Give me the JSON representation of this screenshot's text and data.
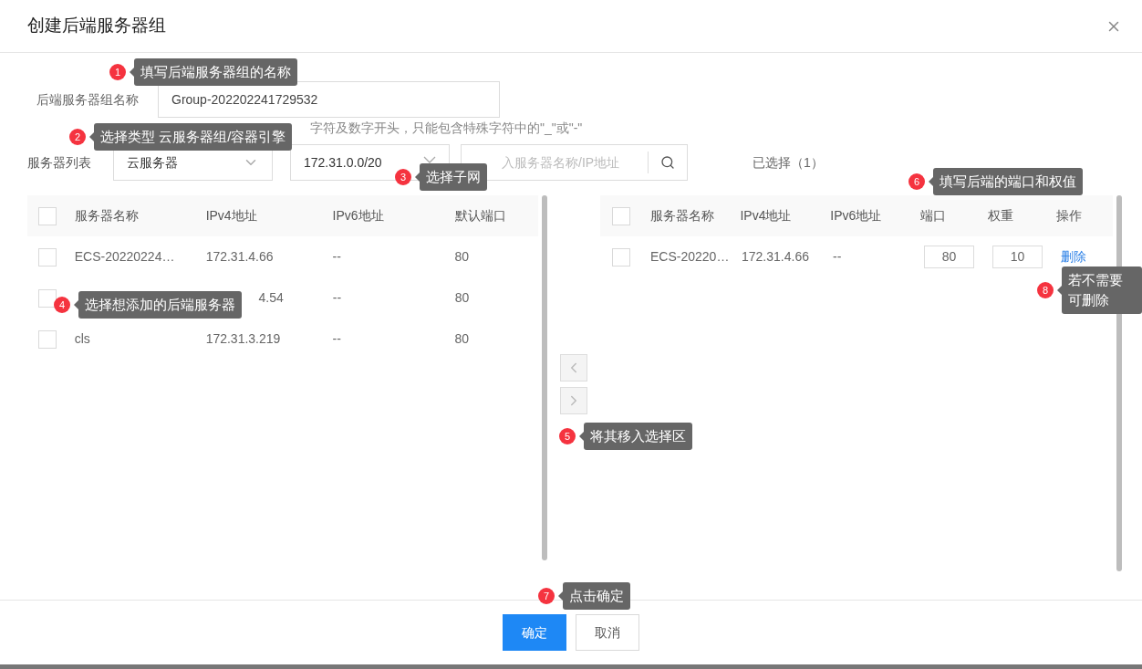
{
  "dialog": {
    "title": "创建后端服务器组"
  },
  "name_field": {
    "label": "后端服务器组名称",
    "value": "Group-202202241729532",
    "hint": "字符及数字开头，只能包含特殊字符中的\"_\"或\"-\""
  },
  "server_list": {
    "label": "服务器列表",
    "type_select": "云服务器",
    "subnet_select": "172.31.0.0/20",
    "search_placeholder": "入服务器名称/IP地址"
  },
  "selected_count": "已选择（1）",
  "left_table": {
    "columns": [
      "服务器名称",
      "IPv4地址",
      "IPv6地址",
      "默认端口"
    ],
    "all_checked": false,
    "rows": [
      {
        "name": "ECS-20220224…",
        "ipv4": "172.31.4.66",
        "ipv6": "--",
        "port": "80",
        "checked": false
      },
      {
        "ipv4": "4.54",
        "ipv6": "--",
        "port": "80",
        "checked": false
      },
      {
        "name": "cls",
        "ipv4": "172.31.3.219",
        "ipv6": "--",
        "port": "80",
        "checked": false
      }
    ]
  },
  "right_table": {
    "columns": [
      "服务器名称",
      "IPv4地址",
      "IPv6地址",
      "端口",
      "权重",
      "操作"
    ],
    "all_checked": false,
    "rows": [
      {
        "name": "ECS-20220…",
        "ipv4": "172.31.4.66",
        "ipv6": "--",
        "port": "80",
        "weight": "10",
        "action": "删除",
        "checked": false
      }
    ]
  },
  "buttons": [
    {
      "label": "确定",
      "kind": "primary"
    },
    {
      "label": "取消",
      "kind": "secondary"
    }
  ],
  "callouts": [
    {
      "number": "1",
      "text": "填写后端服务器组的名称"
    },
    {
      "number": "2",
      "text": "选择类型 云服务器组/容器引擎"
    },
    {
      "number": "3",
      "text": "选择子网"
    },
    {
      "number": "4",
      "text": "选择想添加的后端服务器"
    },
    {
      "number": "5",
      "text": "将其移入选择区"
    },
    {
      "number": "6",
      "text": "填写后端的端口和权值"
    },
    {
      "number": "7",
      "text": "点击确定"
    },
    {
      "number": "8",
      "text": "若不需要可删除"
    }
  ]
}
